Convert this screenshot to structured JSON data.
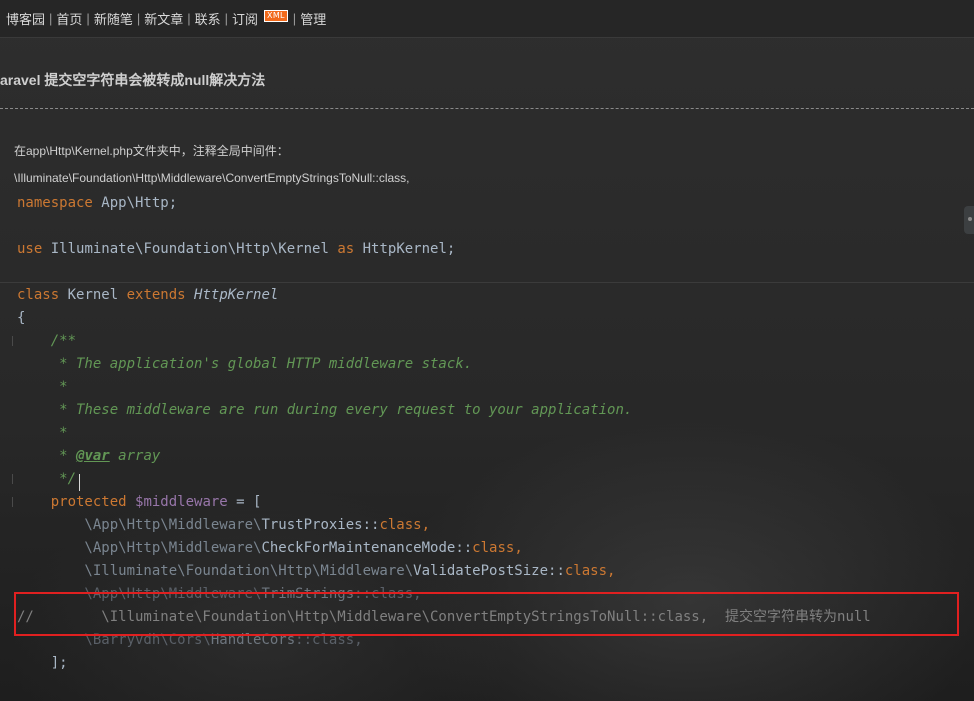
{
  "nav": {
    "items": [
      "博客园",
      "首页",
      "新随笔",
      "新文章",
      "联系",
      "订阅"
    ],
    "xml_badge": "XML",
    "manage": "管理",
    "separator": "|"
  },
  "post": {
    "title": "aravel 提交空字符串会被转成null解决方法",
    "intro_line_1": "在app\\Http\\Kernel.php文件夹中，注释全局中间件：",
    "intro_line_2": "\\Illuminate\\Foundation\\Http\\Middleware\\ConvertEmptyStringsToNull::class,"
  },
  "code": {
    "l1_kw": "namespace",
    "l1_rest": " App\\Http;",
    "l2_kw": "use",
    "l2_mid": " Illuminate\\Foundation\\Http\\Kernel ",
    "l2_as": "as",
    "l2_end": " HttpKernel;",
    "l3_kw": "class",
    "l3_name": " Kernel ",
    "l3_ext": "extends",
    "l3_parent": " HttpKernel",
    "l4": "{",
    "d1": "    /**",
    "d2": "     * The application's global HTTP middleware stack.",
    "d3": "     *",
    "d4": "     * These middleware are run during every request to your application.",
    "d5": "     *",
    "d6_pre": "     * ",
    "d6_tag": "@var",
    "d6_post": " array",
    "d7": "     */",
    "p_kw": "    protected ",
    "p_var": "$middleware",
    "p_rest": " = [",
    "m1_ns": "        \\App\\Http\\Middleware\\",
    "m1_cls": "TrustProxies",
    "m1_end": "::",
    "m1_kw": "class",
    "m1_comma": ",",
    "m2_ns": "        \\App\\Http\\Middleware\\",
    "m2_cls": "CheckForMaintenanceMode",
    "m2_end": "::",
    "m2_kw": "class",
    "m2_comma": ",",
    "m3_ns": "        \\Illuminate\\Foundation\\Http\\Middleware\\",
    "m3_cls": "ValidatePostSize",
    "m3_end": "::",
    "m3_kw": "class",
    "m3_comma": ",",
    "m4_ns": "        \\App\\Http\\Middleware\\",
    "m4_cls": "TrimStrings",
    "m4_end": "::",
    "m4_kw": "class",
    "m4_comma": ",",
    "c_line": "//        \\Illuminate\\Foundation\\Http\\Middleware\\ConvertEmptyStringsToNull::class,  提交空字符串转为null",
    "m5_ns": "        \\Barryvdh\\Cors\\",
    "m5_cls": "HandleCors",
    "m5_end": "::",
    "m5_kw": "class",
    "m5_comma": ",",
    "close": "    ];"
  },
  "colors": {
    "keyword": "#cc7832",
    "docComment": "#629755",
    "variable": "#9876aa",
    "highlight": "#e02020",
    "xmlBadge": "#f26a1b"
  }
}
